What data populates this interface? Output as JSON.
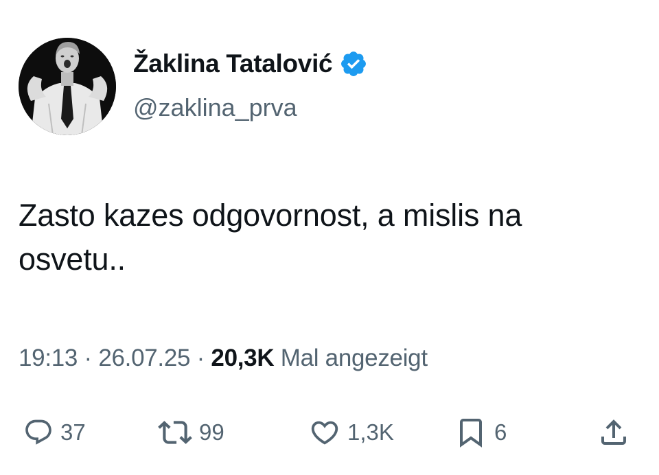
{
  "author": {
    "display_name": "Žaklina Tatalović",
    "handle": "@zaklina_prva",
    "verified": true,
    "verified_color": "#1d9bf0"
  },
  "tweet": {
    "text": "Zasto kazes odgovornost, a mislis na osvetu..",
    "time": "19:13",
    "separator": "·",
    "date": "26.07.25",
    "views_count": "20,3K",
    "views_label": "Mal angezeigt"
  },
  "actions": {
    "replies": "37",
    "retweets": "99",
    "likes": "1,3K",
    "bookmarks": "6"
  },
  "colors": {
    "text_primary": "#0f1419",
    "text_secondary": "#536471",
    "accent": "#1d9bf0"
  }
}
